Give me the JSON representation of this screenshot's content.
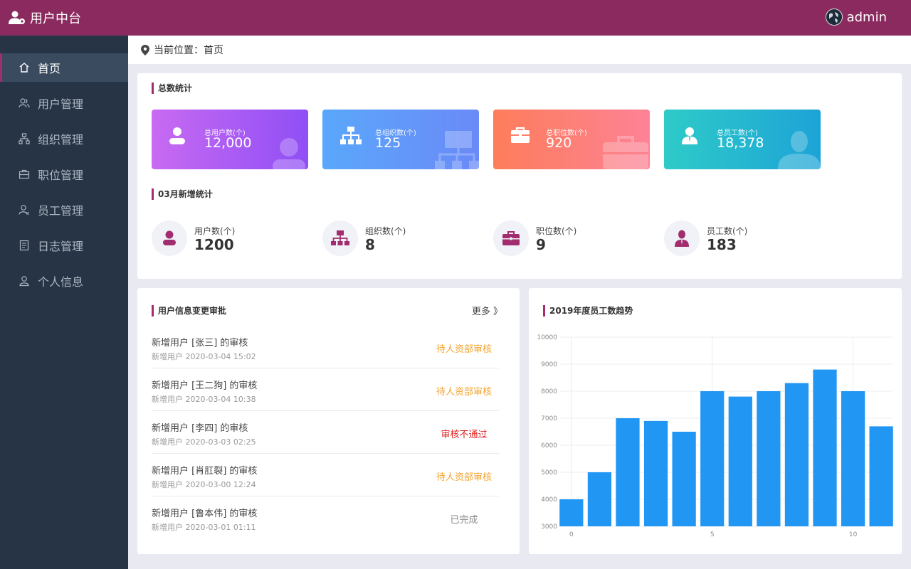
{
  "app": {
    "title": "用户中台",
    "user": "admin"
  },
  "sidebar": {
    "items": [
      {
        "label": "首页",
        "icon": "home-icon",
        "active": true
      },
      {
        "label": "用户管理",
        "icon": "users-icon"
      },
      {
        "label": "组织管理",
        "icon": "org-icon"
      },
      {
        "label": "职位管理",
        "icon": "briefcase-icon"
      },
      {
        "label": "员工管理",
        "icon": "employee-icon"
      },
      {
        "label": "日志管理",
        "icon": "log-icon"
      },
      {
        "label": "个人信息",
        "icon": "person-icon"
      }
    ]
  },
  "breadcrumb": {
    "prefix": "当前位置：",
    "current": "首页"
  },
  "totals": {
    "title": "总数统计",
    "cards": [
      {
        "label": "总用户数(个)",
        "value": "12,000",
        "icon": "user-icon",
        "colors": [
          "#c86af2",
          "#8f4ff5"
        ]
      },
      {
        "label": "总组织数(个)",
        "value": "125",
        "icon": "org-icon",
        "colors": [
          "#5aa7fb",
          "#6a8af7"
        ]
      },
      {
        "label": "总职位数(个)",
        "value": "920",
        "icon": "briefcase-icon",
        "colors": [
          "#fd7d5a",
          "#fd8296"
        ]
      },
      {
        "label": "总员工数(个)",
        "value": "18,378",
        "icon": "employee-icon",
        "colors": [
          "#2ecbc8",
          "#1da3d7"
        ]
      }
    ]
  },
  "monthly": {
    "title": "03月新增统计",
    "items": [
      {
        "label": "用户数(个)",
        "value": "1200",
        "icon": "user-icon"
      },
      {
        "label": "组织数(个)",
        "value": "8",
        "icon": "org-icon"
      },
      {
        "label": "职位数(个)",
        "value": "9",
        "icon": "briefcase-icon"
      },
      {
        "label": "员工数(个)",
        "value": "183",
        "icon": "employee-icon"
      }
    ],
    "icon_color": "#a12c6e"
  },
  "approvals": {
    "title": "用户信息变更审批",
    "more": "更多 》",
    "items": [
      {
        "title": "新增用户 [张三] 的审核",
        "sub": "新增用户 2020-03-04 15:02",
        "status": "待人资部审核",
        "color": "#f3a42e"
      },
      {
        "title": "新增用户 [王二狗] 的审核",
        "sub": "新增用户 2020-03-04 10:38",
        "status": "待人资部审核",
        "color": "#f3a42e"
      },
      {
        "title": "新增用户 [李四] 的审核",
        "sub": "新增用户 2020-03-03 02:25",
        "status": "审核不通过",
        "color": "#e02020"
      },
      {
        "title": "新增用户 [肖肛裂] 的审核",
        "sub": "新增用户 2020-03-00 12:24",
        "status": "待人资部审核",
        "color": "#f3a42e"
      },
      {
        "title": "新增用户 [鲁本伟] 的审核",
        "sub": "新增用户 2020-03-01 01:11",
        "status": "已完成",
        "color": "#888888"
      }
    ]
  },
  "chart_panel": {
    "title": "2019年度员工数趋势"
  },
  "chart_data": {
    "type": "bar",
    "x": [
      0,
      1,
      2,
      3,
      4,
      5,
      6,
      7,
      8,
      9,
      10,
      11
    ],
    "values": [
      4000,
      5000,
      7000,
      6900,
      6500,
      8000,
      7800,
      8000,
      8300,
      8800,
      8000,
      6700
    ],
    "ylim": [
      3000,
      10000
    ],
    "yticks": [
      3000,
      4000,
      5000,
      6000,
      7000,
      8000,
      9000,
      10000
    ],
    "xticks": [
      0,
      5,
      10
    ],
    "grid": true,
    "color": "#2196f3"
  }
}
